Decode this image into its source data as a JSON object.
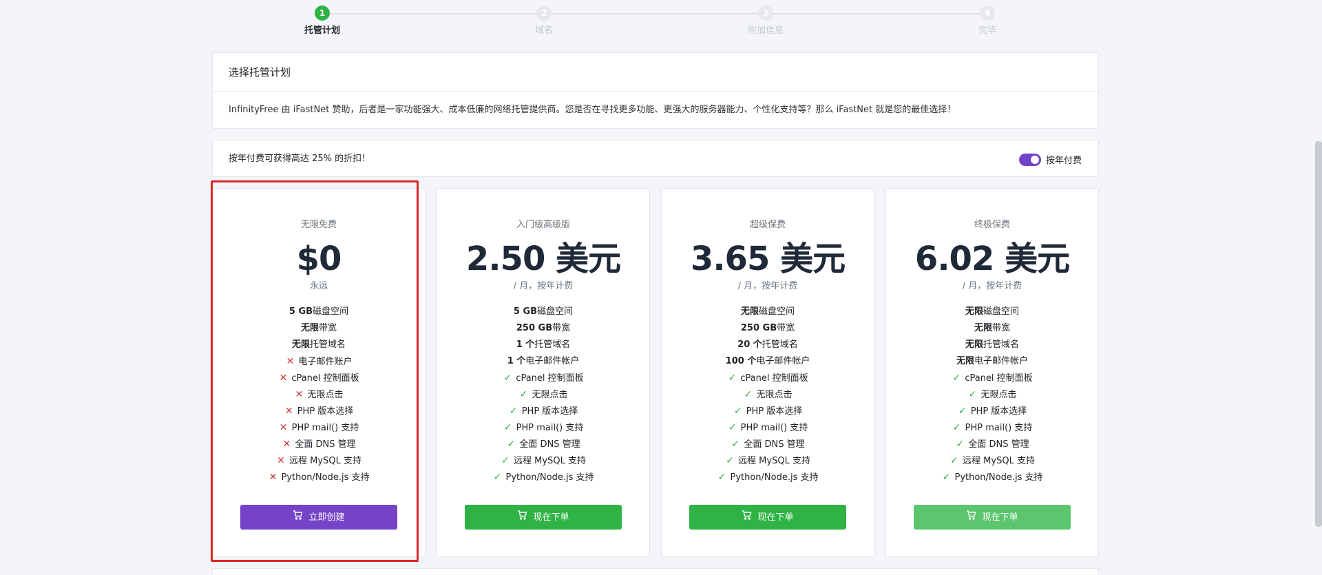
{
  "stepper": {
    "steps": [
      {
        "number": "1",
        "label": "托管计划",
        "active": true
      },
      {
        "number": "2",
        "label": "域名",
        "active": false
      },
      {
        "number": "3",
        "label": "附加信息",
        "active": false
      },
      {
        "number": "4",
        "label": "完毕",
        "active": false
      }
    ]
  },
  "header": {
    "title": "选择托管计划",
    "description": "InfinityFree 由 iFastNet 赞助，后者是一家功能强大、成本低廉的网络托管提供商。您是否在寻找更多功能、更强大的服务器能力、个性化支持等？那么 iFastNet 就是您的最佳选择！"
  },
  "billing": {
    "text": "按年付费可获得高达 25% 的折扣！",
    "toggle_label": "按年付费",
    "toggle_on": true
  },
  "colors": {
    "accent": "#7443c7",
    "success": "#2fb344",
    "danger": "#d63939",
    "highlight": "#dc2626"
  },
  "plans": [
    {
      "name": "无限免费",
      "price": "$0",
      "period": "永远",
      "features": [
        {
          "bold": "5 GB",
          "text": "磁盘空间"
        },
        {
          "bold": "无限",
          "text": "带宽"
        },
        {
          "bold": "无限",
          "text": "托管域名"
        },
        {
          "mark": "no",
          "text": "电子邮件账户"
        },
        {
          "mark": "no",
          "text": "cPanel 控制面板"
        },
        {
          "mark": "no",
          "text": "无限点击"
        },
        {
          "mark": "no",
          "text": "PHP 版本选择"
        },
        {
          "mark": "no",
          "text": "PHP mail() 支持"
        },
        {
          "mark": "no",
          "text": "全面 DNS 管理"
        },
        {
          "mark": "no",
          "text": "远程 MySQL 支持"
        },
        {
          "mark": "no",
          "text": "Python/Node.js 支持"
        }
      ],
      "button": "立即创建",
      "button_style": "purple"
    },
    {
      "name": "入门级高级版",
      "price": "2.50 美元",
      "period": "/ 月，按年计费",
      "features": [
        {
          "bold": "5 GB",
          "text": "磁盘空间"
        },
        {
          "bold": "250 GB",
          "text": "带宽"
        },
        {
          "bold": "1 个",
          "text": "托管域名"
        },
        {
          "bold": "1 个",
          "text": "电子邮件帐户"
        },
        {
          "mark": "yes",
          "text": "cPanel 控制面板"
        },
        {
          "mark": "yes",
          "text": "无限点击"
        },
        {
          "mark": "yes",
          "text": "PHP 版本选择"
        },
        {
          "mark": "yes",
          "text": "PHP mail() 支持"
        },
        {
          "mark": "yes",
          "text": "全面 DNS 管理"
        },
        {
          "mark": "yes",
          "text": "远程 MySQL 支持"
        },
        {
          "mark": "yes",
          "text": "Python/Node.js 支持"
        }
      ],
      "button": "现在下单",
      "button_style": "green"
    },
    {
      "name": "超级保费",
      "price": "3.65 美元",
      "period": "/ 月，按年计费",
      "features": [
        {
          "bold": "无限",
          "text": "磁盘空间"
        },
        {
          "bold": "250 GB",
          "text": "带宽"
        },
        {
          "bold": "20 个",
          "text": "托管域名"
        },
        {
          "bold": "100 个",
          "text": "电子邮件帐户"
        },
        {
          "mark": "yes",
          "text": "cPanel 控制面板"
        },
        {
          "mark": "yes",
          "text": "无限点击"
        },
        {
          "mark": "yes",
          "text": "PHP 版本选择"
        },
        {
          "mark": "yes",
          "text": "PHP mail() 支持"
        },
        {
          "mark": "yes",
          "text": "全面 DNS 管理"
        },
        {
          "mark": "yes",
          "text": "远程 MySQL 支持"
        },
        {
          "mark": "yes",
          "text": "Python/Node.js 支持"
        }
      ],
      "button": "现在下单",
      "button_style": "green"
    },
    {
      "name": "终极保费",
      "price": "6.02 美元",
      "period": "/ 月，按年计费",
      "features": [
        {
          "bold": "无限",
          "text": "磁盘空间"
        },
        {
          "bold": "无限",
          "text": "带宽"
        },
        {
          "bold": "无限",
          "text": "托管域名"
        },
        {
          "bold": "无限",
          "text": "电子邮件帐户"
        },
        {
          "mark": "yes",
          "text": "cPanel 控制面板"
        },
        {
          "mark": "yes",
          "text": "无限点击"
        },
        {
          "mark": "yes",
          "text": "PHP 版本选择"
        },
        {
          "mark": "yes",
          "text": "PHP mail() 支持"
        },
        {
          "mark": "yes",
          "text": "全面 DNS 管理"
        },
        {
          "mark": "yes",
          "text": "远程 MySQL 支持"
        },
        {
          "mark": "yes",
          "text": "Python/Node.js 支持"
        }
      ],
      "button": "现在下单",
      "button_style": "green-light"
    }
  ]
}
